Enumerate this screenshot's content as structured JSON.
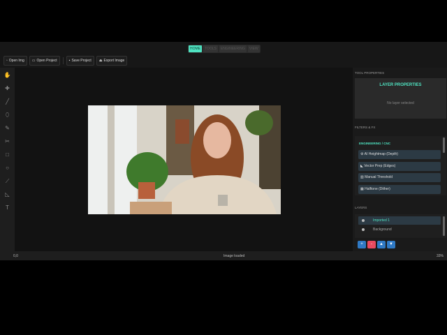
{
  "tabs": [
    "HOME",
    "TOOLS",
    "ENGINEERING",
    "VIEW"
  ],
  "toolbar": {
    "open_img": "Open Img",
    "open_project": "Open Project",
    "save_project": "Save Project",
    "export_image": "Export Image"
  },
  "right": {
    "tool_properties": "TOOL PROPERTIES",
    "layer_properties": "LAYER PROPERTIES",
    "no_layer": "No layer selected",
    "filters_fx": "FILTERS & FX",
    "engineering_cnc": "ENGINEERING / CNC",
    "filters": [
      "⚙ AI Heightmap (Depth)",
      "◣ Vector Prep (Edges)",
      "▥      Manual Threshold",
      "▦ Halftone (Dither)"
    ],
    "layers_title": "LAYERS",
    "layers": [
      "Imported 1",
      "Background"
    ],
    "layer_buttons": [
      "+",
      "-",
      "▲",
      "▼"
    ]
  },
  "status": {
    "coords": "0,0",
    "message": "Image loaded",
    "zoom": "33%"
  }
}
